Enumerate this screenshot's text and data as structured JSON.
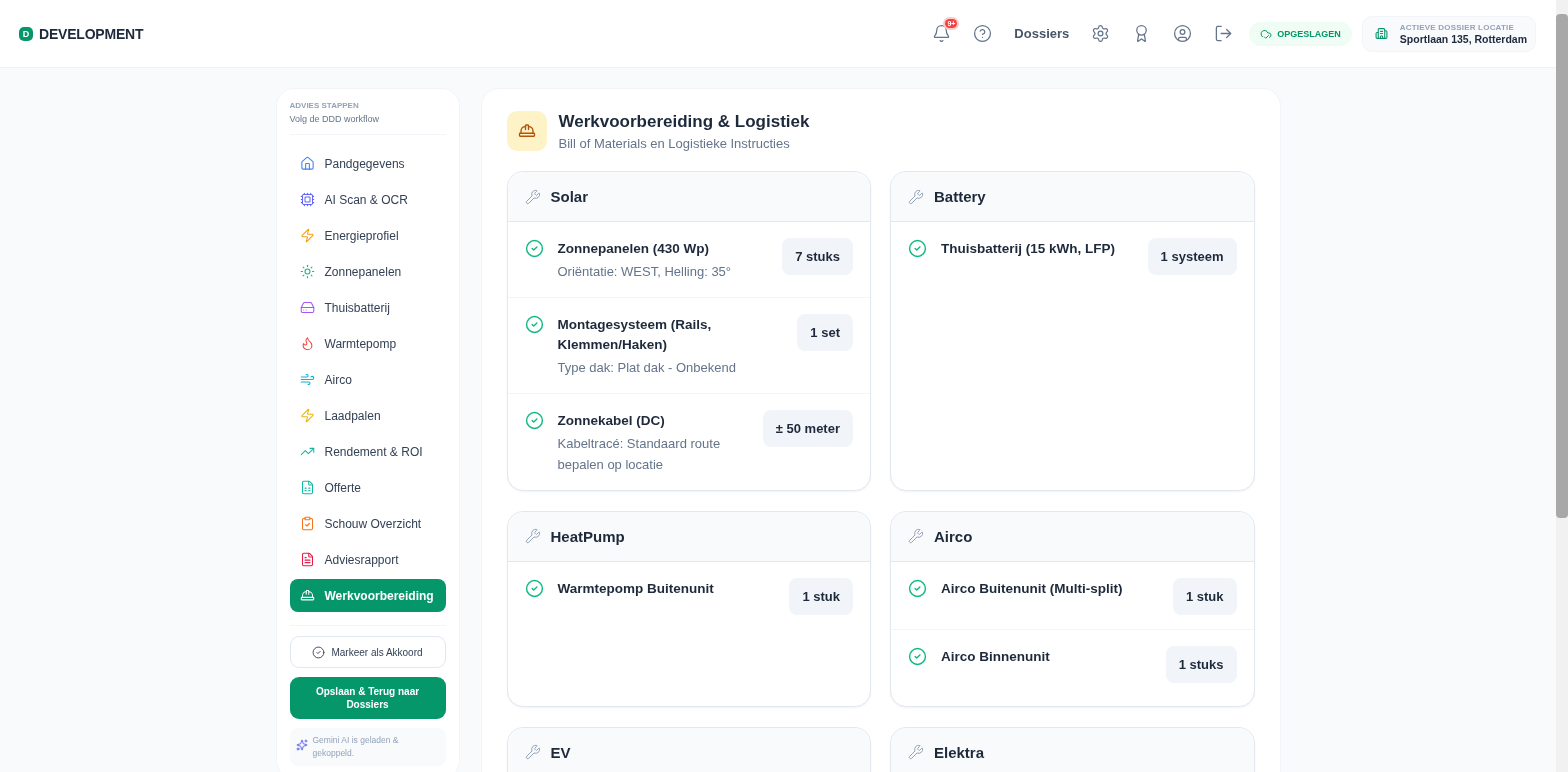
{
  "header": {
    "logo_letter": "D",
    "brand": "DEVELOPMENT",
    "notification_count": "9+",
    "nav_link": "Dossiers",
    "save_status": "OPGESLAGEN",
    "location_label": "ACTIEVE DOSSIER LOCATIE",
    "location_value": "Sportlaan 135, Rotterdam"
  },
  "sidebar": {
    "title": "ADVIES STAPPEN",
    "subtitle": "Volg de DDD workflow",
    "items": [
      {
        "label": "Pandgegevens",
        "selected": false
      },
      {
        "label": "AI Scan & OCR",
        "selected": false
      },
      {
        "label": "Energieprofiel",
        "selected": false
      },
      {
        "label": "Zonnepanelen",
        "selected": false
      },
      {
        "label": "Thuisbatterij",
        "selected": false
      },
      {
        "label": "Warmtepomp",
        "selected": false
      },
      {
        "label": "Airco",
        "selected": false
      },
      {
        "label": "Laadpalen",
        "selected": false
      },
      {
        "label": "Rendement & ROI",
        "selected": false
      },
      {
        "label": "Offerte",
        "selected": false
      },
      {
        "label": "Schouw Overzicht",
        "selected": false
      },
      {
        "label": "Adviesrapport",
        "selected": false
      },
      {
        "label": "Werkvoorbereiding",
        "selected": true
      }
    ],
    "approve_button": "Markeer als Akkoord",
    "save_button": "Opslaan & Terug naar Dossiers",
    "ai_status": "Gemini AI is geladen & gekoppeld."
  },
  "main": {
    "title": "Werkvoorbereiding & Logistiek",
    "subtitle": "Bill of Materials en Logistieke Instructies",
    "sections": [
      {
        "name": "Solar",
        "items": [
          {
            "name": "Zonnepanelen (430 Wp)",
            "detail": "Oriëntatie: WEST, Helling: 35°",
            "quantity": "7 stuks",
            "checked": true
          },
          {
            "name": "Montagesysteem (Rails, Klemmen/Haken)",
            "detail": "Type dak: Plat dak - Onbekend",
            "quantity": "1 set",
            "checked": true
          },
          {
            "name": "Zonnekabel (DC)",
            "detail": "Kabeltracé: Standaard route bepalen op locatie",
            "quantity": "± 50 meter",
            "checked": true
          }
        ]
      },
      {
        "name": "Battery",
        "items": [
          {
            "name": "Thuisbatterij (15 kWh, LFP)",
            "quantity": "1 systeem",
            "checked": true
          }
        ]
      },
      {
        "name": "HeatPump",
        "items": [
          {
            "name": "Warmtepomp Buitenunit",
            "quantity": "1 stuk",
            "checked": true
          }
        ]
      },
      {
        "name": "Airco",
        "items": [
          {
            "name": "Airco Buitenunit (Multi-split)",
            "quantity": "1 stuk",
            "checked": true
          },
          {
            "name": "Airco Binnenunit",
            "quantity": "1 stuks",
            "checked": true
          }
        ]
      },
      {
        "name": "EV"
      },
      {
        "name": "Elektra"
      }
    ]
  }
}
